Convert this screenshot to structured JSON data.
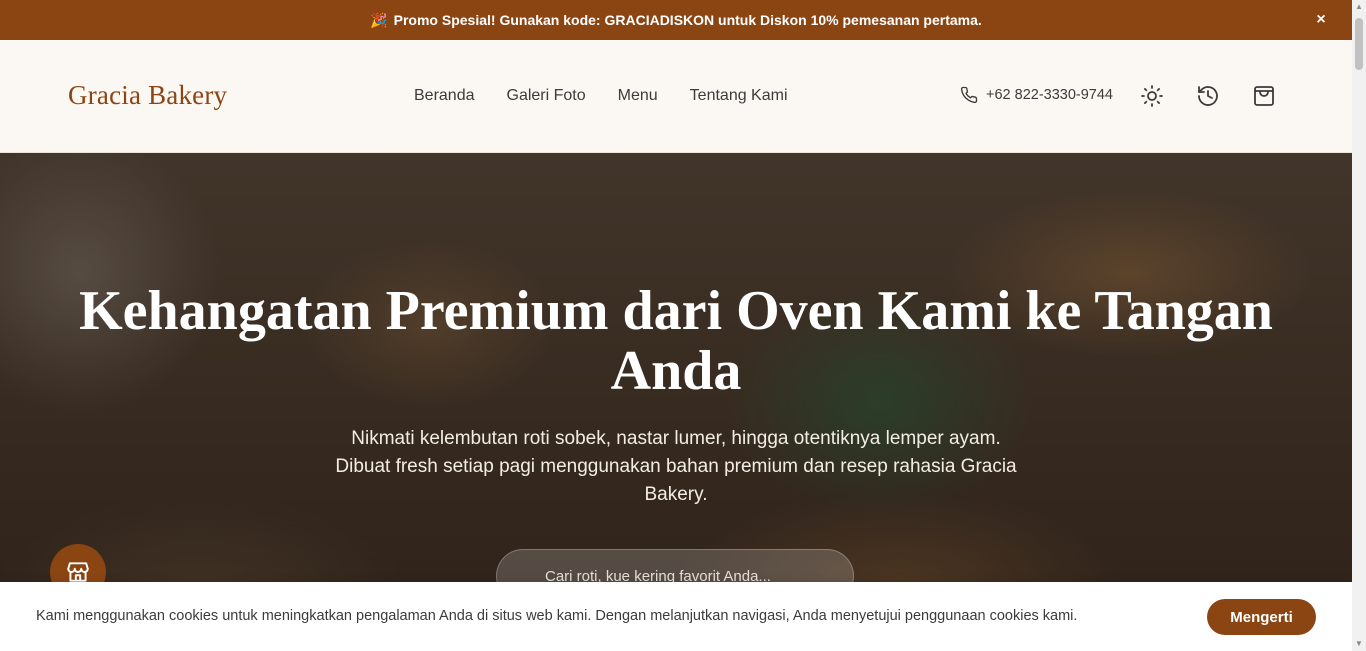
{
  "promo": {
    "emoji": "🎉",
    "text": "Promo Spesial! Gunakan kode: GRACIADISKON untuk Diskon 10% pemesanan pertama.",
    "close": "×"
  },
  "header": {
    "brand": "Gracia Bakery",
    "nav": [
      "Beranda",
      "Galeri Foto",
      "Menu",
      "Tentang Kami"
    ],
    "phone": "+62 822-3330-9744",
    "icons": [
      "phone-icon",
      "sun-icon",
      "history-icon",
      "shopping-bag-icon"
    ]
  },
  "hero": {
    "title": "Kehangatan Premium dari Oven Kami ke Tangan Anda",
    "subtitle": "Nikmati kelembutan roti sobek, nastar lumer, hingga otentiknya lemper ayam. Dibuat fresh setiap pagi menggunakan bahan premium dan resep rahasia Gracia Bakery.",
    "search_placeholder": "Cari roti, kue kering favorit Anda..."
  },
  "cookie": {
    "text": "Kami menggunakan cookies untuk meningkatkan pengalaman Anda di situs web kami. Dengan melanjutkan navigasi, Anda menyetujui penggunaan cookies kami.",
    "button": "Mengerti"
  },
  "colors": {
    "accent": "#8b4513",
    "background": "#fbf8f4"
  }
}
